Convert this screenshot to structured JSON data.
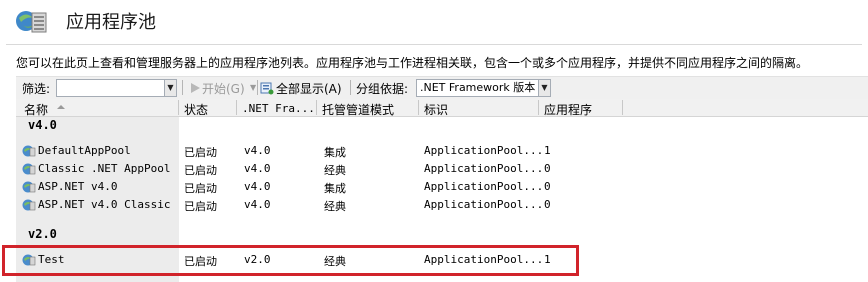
{
  "header": {
    "title": "应用程序池"
  },
  "description": "您可以在此页上查看和管理服务器上的应用程序池列表。应用程序池与工作进程相关联，包含一个或多个应用程序，并提供不同应用程序之间的隔离。",
  "toolbar": {
    "filter_label": "筛选:",
    "filter_value": "",
    "go_label": "开始(G)",
    "show_all_label": "全部显示(A)",
    "group_by_label": "分组依据:",
    "group_by_value": ".NET Framework 版本"
  },
  "columns": [
    "名称",
    "状态",
    ".NET Fra...",
    "托管管道模式",
    "标识",
    "应用程序"
  ],
  "groups": [
    {
      "label": "v4.0",
      "rows": [
        {
          "name": "DefaultAppPool",
          "status": "已启动",
          "netfx": "v4.0",
          "mode": "集成",
          "identity": "ApplicationPool...",
          "apps": "1"
        },
        {
          "name": "Classic .NET AppPool",
          "status": "已启动",
          "netfx": "v4.0",
          "mode": "经典",
          "identity": "ApplicationPool...",
          "apps": "0"
        },
        {
          "name": "ASP.NET v4.0",
          "status": "已启动",
          "netfx": "v4.0",
          "mode": "集成",
          "identity": "ApplicationPool...",
          "apps": "0"
        },
        {
          "name": "ASP.NET v4.0 Classic",
          "status": "已启动",
          "netfx": "v4.0",
          "mode": "经典",
          "identity": "ApplicationPool...",
          "apps": "0"
        }
      ]
    },
    {
      "label": "v2.0",
      "rows": [
        {
          "name": "Test",
          "status": "已启动",
          "netfx": "v2.0",
          "mode": "经典",
          "identity": "ApplicationPool...",
          "apps": "1"
        }
      ]
    }
  ],
  "colors": {
    "highlight_border": "#d1232a",
    "toolbar_bg": "#f0f0f0"
  }
}
